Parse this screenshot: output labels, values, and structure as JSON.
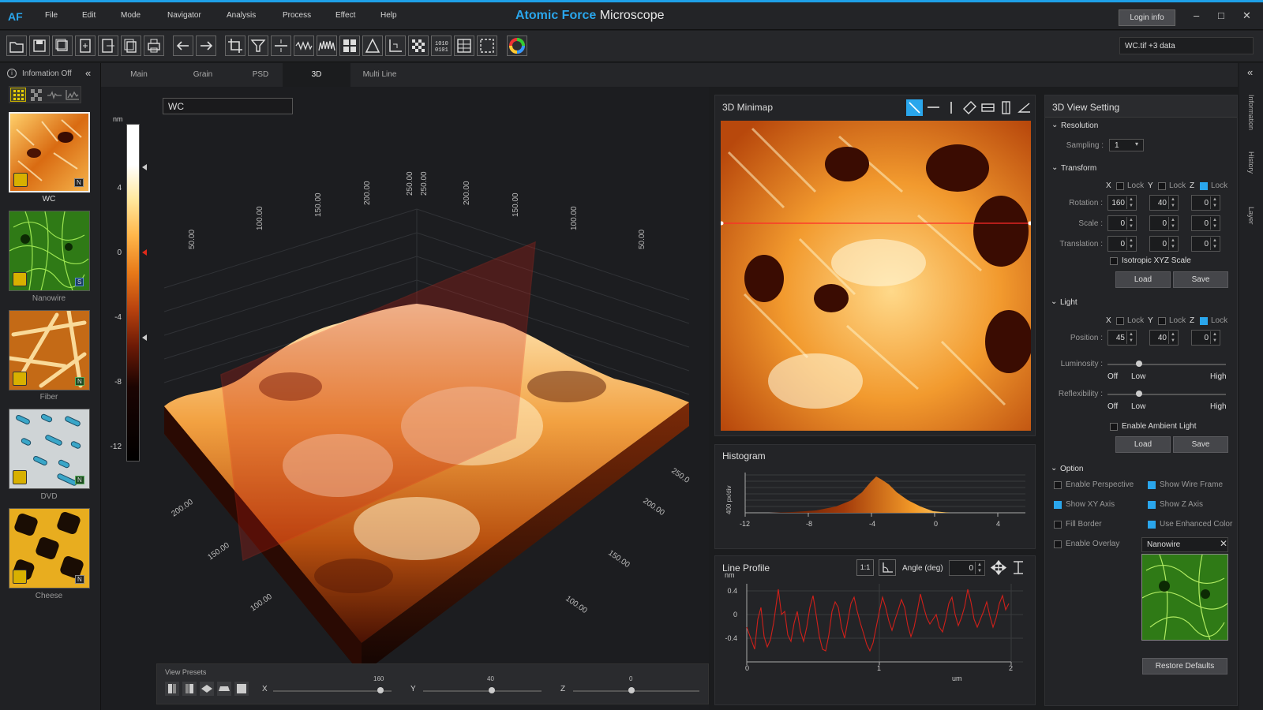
{
  "app": {
    "logo": "AF",
    "title_accent": "Atomic Force",
    "title_rest": " Microscope",
    "login_label": "Login info",
    "file_info": "WC.tif +3 data"
  },
  "menu": [
    "File",
    "Edit",
    "Mode",
    "Navigator",
    "Analysis",
    "Process",
    "Effect",
    "Help"
  ],
  "window_controls": [
    "–",
    "□",
    "✕"
  ],
  "left": {
    "info_label": "Infomation Off",
    "thumbnails": [
      {
        "label": "WC",
        "badge": "N"
      },
      {
        "label": "Nanowire",
        "badge": "S"
      },
      {
        "label": "Fiber",
        "badge": "N"
      },
      {
        "label": "DVD",
        "badge": "N"
      },
      {
        "label": "Cheese",
        "badge": "N"
      }
    ]
  },
  "tabs": [
    "Main",
    "Grain",
    "PSD",
    "3D",
    "Multi Line"
  ],
  "view3d": {
    "dataset_name": "WC",
    "colorbar_unit": "nm",
    "colorbar_ticks": [
      "4",
      "0",
      "-4",
      "-8",
      "-12"
    ],
    "back_axis_labels": [
      "50.00",
      "100.00",
      "150.00",
      "200.00",
      "250.00",
      "250.00",
      "200.00",
      "150.00",
      "100.00",
      "50.00"
    ],
    "left_axis_labels": [
      "200.00",
      "150.00",
      "100.00"
    ],
    "right_axis_labels": [
      "250.0",
      "200.00",
      "150.00",
      "100.00"
    ],
    "presets_label": "View Presets",
    "sliders": [
      {
        "axis": "X",
        "value": "160"
      },
      {
        "axis": "Y",
        "value": "40"
      },
      {
        "axis": "Z",
        "value": "0"
      }
    ]
  },
  "minimap": {
    "title": "3D Minimap"
  },
  "histogram": {
    "title": "Histogram",
    "ylabel": "400 px/div",
    "x_ticks": [
      "-12",
      "-8",
      "-4",
      "0",
      "4"
    ]
  },
  "line_profile": {
    "title": "Line Profile",
    "ratio_label": "1:1",
    "angle_label": "Angle (deg)",
    "angle_value": "0",
    "y_unit": "nm",
    "y_ticks": [
      "0.4",
      "0",
      "-0.4"
    ],
    "x_ticks": [
      "0",
      "1",
      "2"
    ],
    "x_unit": "um"
  },
  "settings": {
    "title": "3D View Setting",
    "resolution": {
      "header": "Resolution",
      "sampling_label": "Sampling :",
      "sampling_value": "1"
    },
    "transform": {
      "header": "Transform",
      "axes": [
        "X",
        "Y",
        "Z"
      ],
      "lock_label": "Lock",
      "rotation_label": "Rotation :",
      "rotation": [
        "160",
        "40",
        "0"
      ],
      "scale_label": "Scale :",
      "scale": [
        "0",
        "0",
        "0"
      ],
      "translation_label": "Translation :",
      "translation": [
        "0",
        "0",
        "0"
      ],
      "isotropic_label": "Isotropic XYZ Scale",
      "load": "Load",
      "save": "Save"
    },
    "light": {
      "header": "Light",
      "position_label": "Position :",
      "position": [
        "45",
        "40",
        "0"
      ],
      "luminosity_label": "Luminosity :",
      "reflexibility_label": "Reflexibility :",
      "scale_words": [
        "Off",
        "Low",
        "High"
      ],
      "ambient_label": "Enable Ambient Light",
      "load": "Load",
      "save": "Save"
    },
    "option": {
      "header": "Option",
      "items": [
        {
          "label": "Enable Perspective",
          "checked": false
        },
        {
          "label": "Show Wire Frame",
          "checked": true
        },
        {
          "label": "Show XY Axis",
          "checked": true
        },
        {
          "label": "Show Z Axis",
          "checked": true
        },
        {
          "label": "Fill Border",
          "checked": false
        },
        {
          "label": "Use Enhanced Color",
          "checked": true
        },
        {
          "label": "Enable Overlay",
          "checked": false
        }
      ],
      "overlay_name": "Nanowire",
      "restore": "Restore Defaults"
    }
  },
  "right_strip": [
    "Information",
    "History",
    "Layer"
  ]
}
